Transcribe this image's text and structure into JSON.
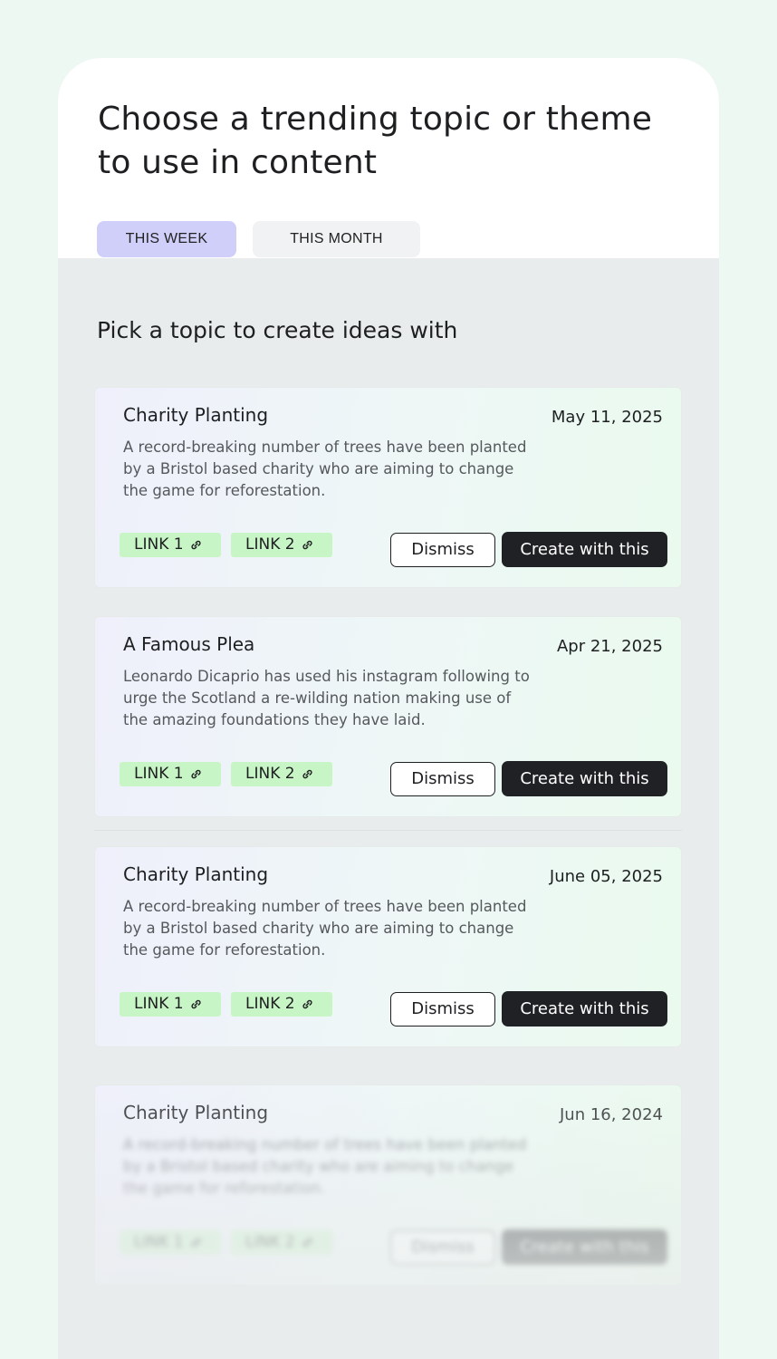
{
  "header": {
    "title": "Choose a trending topic or theme to use in content",
    "tabs": [
      {
        "label": "THIS WEEK",
        "active": true
      },
      {
        "label": "THIS MONTH",
        "active": false
      }
    ]
  },
  "main": {
    "subtitle": "Pick a topic to create ideas with",
    "cards": [
      {
        "title": "Charity Planting",
        "date": "May 11, 2025",
        "description": "A record-breaking number of trees have been planted by a Bristol based charity who are aiming to change the game for reforestation.",
        "link1": "LINK 1",
        "link2": "LINK 2",
        "dismiss": "Dismiss",
        "create": "Create with this"
      },
      {
        "title": "A Famous Plea",
        "date": "Apr 21, 2025",
        "description": "Leonardo Dicaprio has used his instagram following to urge the Scotland a re-wilding nation making use of the amazing foundations they have laid.",
        "link1": "LINK 1",
        "link2": "LINK 2",
        "dismiss": "Dismiss",
        "create": "Create with this"
      },
      {
        "title": "Charity Planting",
        "date": "June 05, 2025",
        "description": "A record-breaking number of trees have been planted by a Bristol based charity who are aiming to change the game for reforestation.",
        "link1": "LINK 1",
        "link2": "LINK 2",
        "dismiss": "Dismiss",
        "create": "Create with this"
      },
      {
        "title": "Charity Planting",
        "date": "Jun 16, 2024",
        "description": "A record-breaking number of trees have been planted by a Bristol based charity who are aiming to change the game for reforestation.",
        "link1": "LINK 1",
        "link2": "LINK 2",
        "dismiss": "Dismiss",
        "create": "Create with this"
      }
    ]
  },
  "colors": {
    "page_background": "#eef8f3",
    "panel_background": "#e9ecec",
    "active_tab": "#cfcffa",
    "inactive_tab": "#f1f2f3",
    "link_chip": "#c8f5c5",
    "primary_button": "#1f2124"
  },
  "icons": {
    "link": "link-chain-icon"
  }
}
